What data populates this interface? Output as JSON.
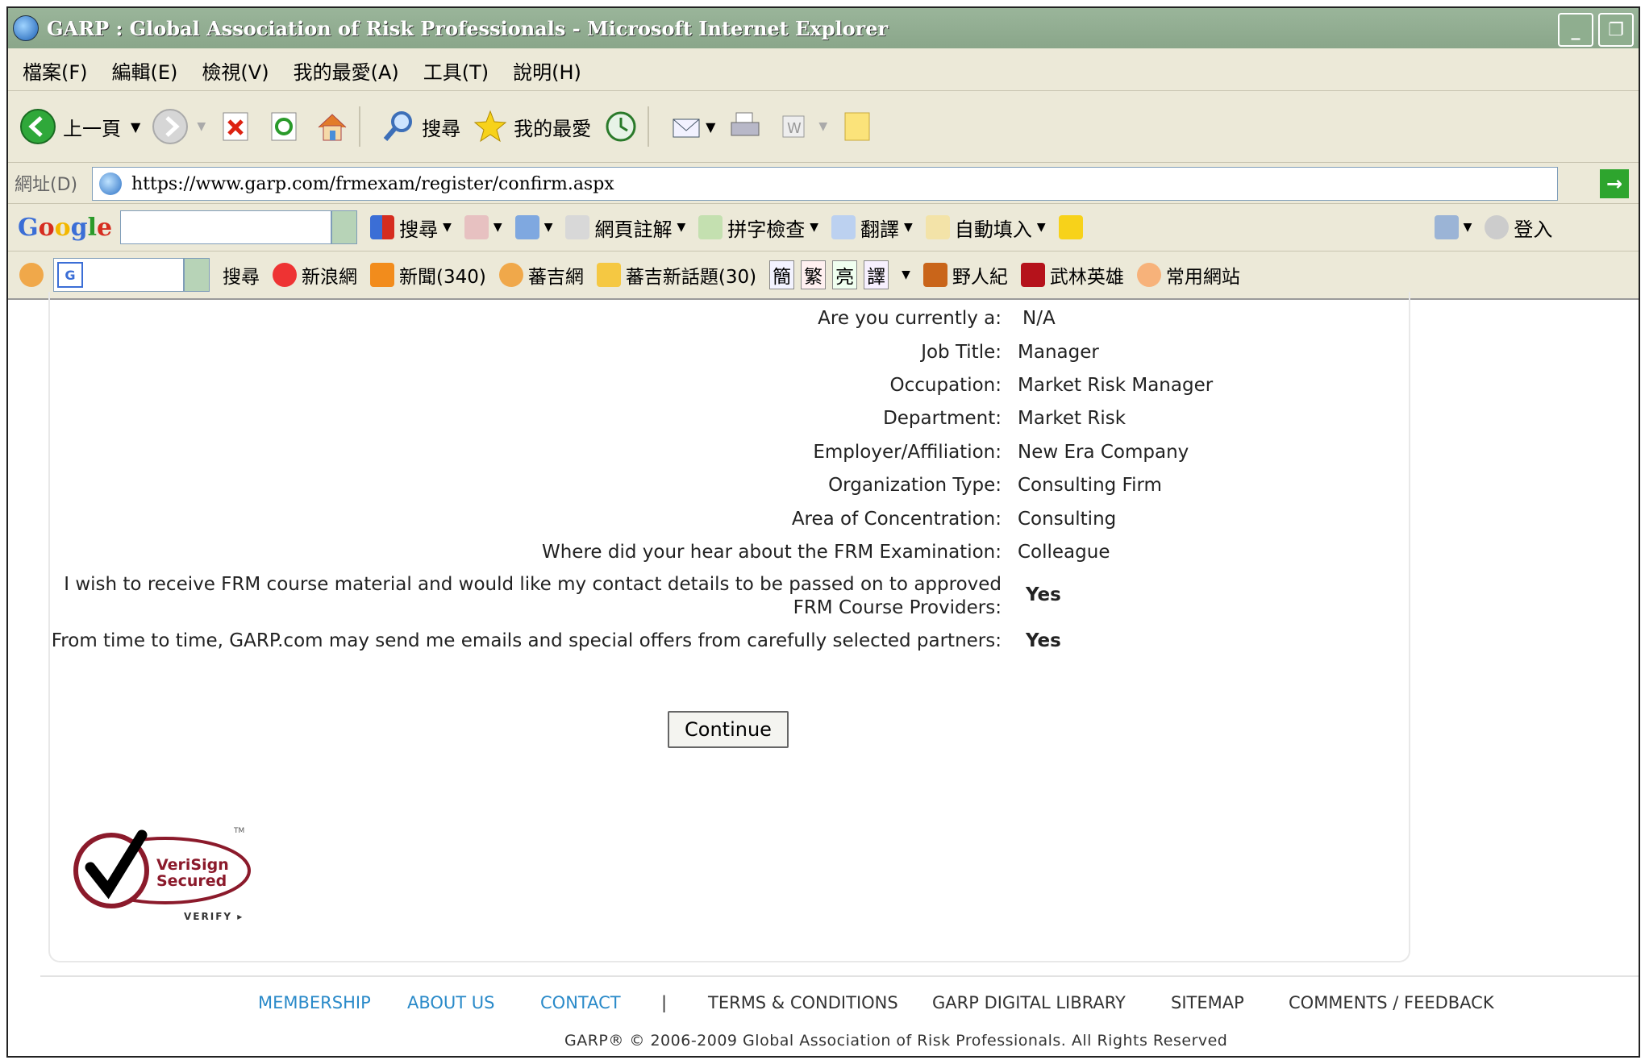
{
  "window": {
    "title": "GARP : Global Association of Risk Professionals - Microsoft Internet Explorer",
    "minimize": "_",
    "restore": "❐"
  },
  "menu": [
    "檔案(F)",
    "編輯(E)",
    "檢視(V)",
    "我的最愛(A)",
    "工具(T)",
    "說明(H)"
  ],
  "toolbar": {
    "back": "上一頁",
    "search": "搜尋",
    "favorites": "我的最愛"
  },
  "address": {
    "label": "網址(D)",
    "url": "https://www.garp.com/frmexam/register/confirm.aspx",
    "go": "移"
  },
  "google_bar": {
    "logo": "Google",
    "search": "搜尋",
    "annotate": "網頁註解",
    "spellcheck": "拼字檢查",
    "translate": "翻譯",
    "autofill": "自動填入",
    "signin": "登入"
  },
  "links_bar": {
    "search": "搜尋",
    "items": [
      "新浪網",
      "新聞(340)",
      "蕃吉網",
      "蕃吉新話題(30)",
      "簡",
      "繁",
      "亮",
      "譯",
      "野人紀",
      "武林英雄",
      "常用網站"
    ]
  },
  "form": {
    "fields": [
      {
        "label": "Are you currently a:",
        "value": "N/A"
      },
      {
        "label": "Job Title:",
        "value": "Manager"
      },
      {
        "label": "Occupation:",
        "value": "Market Risk Manager"
      },
      {
        "label": "Department:",
        "value": "Market Risk"
      },
      {
        "label": "Employer/Affiliation:",
        "value": "New Era Company"
      },
      {
        "label": "Organization Type:",
        "value": "Consulting Firm"
      },
      {
        "label": "Area of Concentration:",
        "value": "Consulting"
      },
      {
        "label": "Where did your hear about the FRM Examination:",
        "value": "Colleague"
      }
    ],
    "consent_1_line1": "I wish to receive FRM course material and would like my contact details to be passed on to approved",
    "consent_1_line2": "FRM Course Providers:",
    "consent_1_value": "Yes",
    "consent_2": "From time to time, GARP.com may send me emails and special offers from carefully selected partners:",
    "consent_2_value": "Yes",
    "continue": "Continue"
  },
  "verisign": {
    "line1": "VeriSign",
    "line2": "Secured",
    "verify": "VERIFY ▸",
    "tm": "TM"
  },
  "footer": {
    "links": [
      "MEMBERSHIP",
      "ABOUT US",
      "CONTACT",
      "|",
      "TERMS & CONDITIONS",
      "GARP DIGITAL LIBRARY",
      "SITEMAP",
      "COMMENTS / FEEDBACK"
    ],
    "copyright": "GARP® © 2006-2009 Global Association of Risk Professionals. All Rights Reserved"
  },
  "colors": {
    "footer_link_blue": "#2a8ac9",
    "titlebar": "#8aa68a"
  }
}
